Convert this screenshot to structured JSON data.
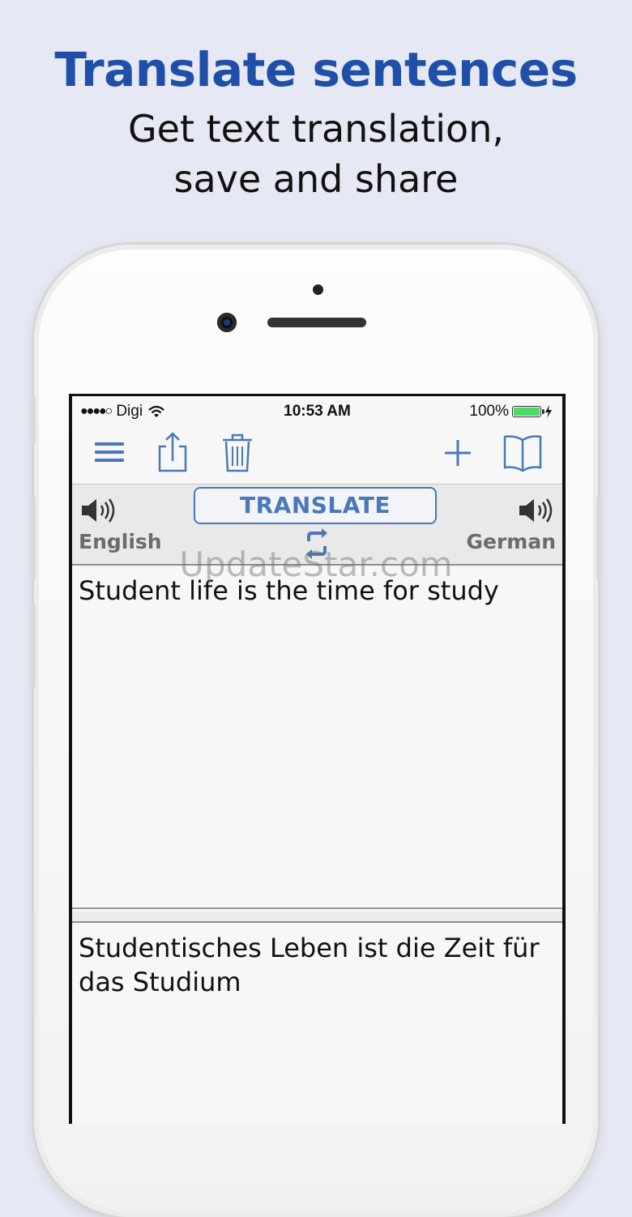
{
  "headline": {
    "title": "Translate sentences",
    "subtitle_line1": "Get text translation,",
    "subtitle_line2": "save and share"
  },
  "status_bar": {
    "carrier": "Digi",
    "time": "10:53 AM",
    "battery": "100%",
    "battery_level": 1.0
  },
  "toolbar": {
    "icons": [
      "menu-icon",
      "share-icon",
      "trash-icon",
      "plus-icon",
      "book-icon"
    ]
  },
  "lang_bar": {
    "translate_label": "TRANSLATE",
    "source_language": "English",
    "target_language": "German"
  },
  "source_text": "Student life is the time for study",
  "target_text": "Studentisches Leben ist die Zeit für das Studium",
  "watermark": "UpdateStar.com",
  "colors": {
    "accent": "#1f4fa8",
    "icon_blue": "#4a78b8",
    "background": "#e6e9f3"
  }
}
